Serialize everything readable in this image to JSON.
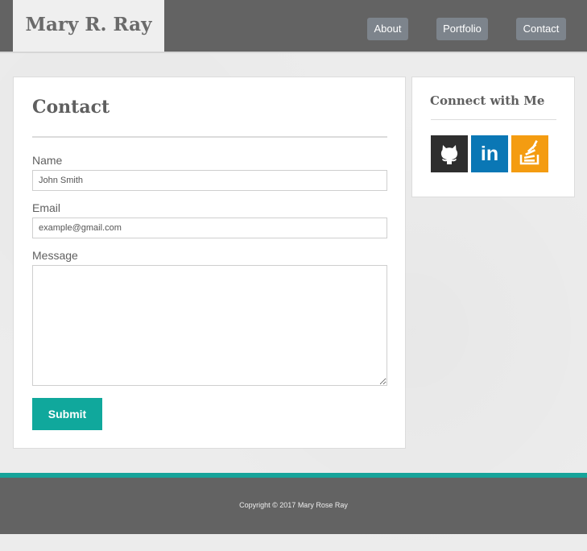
{
  "header": {
    "brand": "Mary R. Ray",
    "nav": [
      {
        "label": "About"
      },
      {
        "label": "Portfolio"
      },
      {
        "label": "Contact"
      }
    ]
  },
  "contact": {
    "title": "Contact",
    "name_label": "Name",
    "name_placeholder": "John Smith",
    "email_label": "Email",
    "email_placeholder": "example@gmail.com",
    "message_label": "Message",
    "message_value": "",
    "submit_label": "Submit"
  },
  "connect": {
    "title": "Connect with Me",
    "links": [
      {
        "icon": "github-icon",
        "color": "#2e2e2e"
      },
      {
        "icon": "linkedin-icon",
        "text": "in",
        "color": "#0a77b5"
      },
      {
        "icon": "stackoverflow-icon",
        "color": "#f49c11"
      }
    ]
  },
  "footer": {
    "copyright": "Copyright © 2017 Mary Rose Ray"
  },
  "colors": {
    "header_bg": "#636363",
    "accent": "#17a49a",
    "submit_bg": "#10a89c",
    "nav_button_bg": "#7d848c"
  }
}
